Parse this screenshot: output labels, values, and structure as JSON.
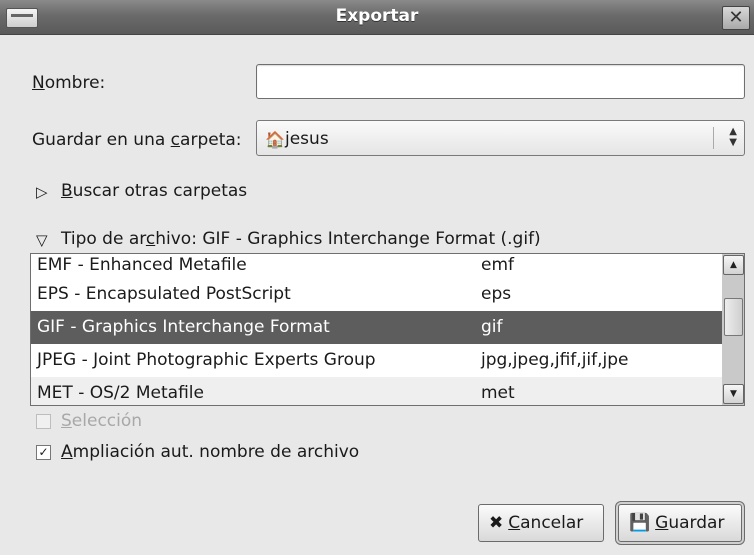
{
  "window": {
    "title": "Exportar",
    "close_glyph": "✕"
  },
  "name_field": {
    "label_prefix": "",
    "mnemonic": "N",
    "label_rest": "ombre:",
    "value": ""
  },
  "folder": {
    "label_prefix": "Guardar en una ",
    "mnemonic": "c",
    "label_rest": "arpeta:",
    "value": "jesus",
    "icon": "folder-home-icon"
  },
  "browse": {
    "expander": "▷",
    "mnemonic": "B",
    "label_rest": "uscar otras carpetas"
  },
  "filetype": {
    "expander": "▽",
    "label_prefix": "Tipo de ar",
    "mnemonic": "c",
    "label_rest": "hivo: GIF - Graphics Interchange Format (.gif)",
    "rows": [
      {
        "name": "EMF - Enhanced Metafile",
        "ext": "emf"
      },
      {
        "name": "EPS - Encapsulated PostScript",
        "ext": "eps"
      },
      {
        "name": "GIF - Graphics Interchange Format",
        "ext": "gif"
      },
      {
        "name": "JPEG - Joint Photographic Experts Group",
        "ext": "jpg,jpeg,jfif,jif,jpe"
      },
      {
        "name": "MET - OS/2 Metafile",
        "ext": "met"
      }
    ],
    "selected_index": 2
  },
  "options": {
    "selection": {
      "mnemonic": "S",
      "label_rest": "elección",
      "checked": false,
      "enabled": false
    },
    "auto_ext": {
      "mnemonic": "A",
      "label_rest": "mpliación aut. nombre de archivo",
      "checked": true,
      "check_glyph": "✓"
    }
  },
  "buttons": {
    "cancel": {
      "icon": "✖",
      "mnemonic": "C",
      "label_rest": "ancelar"
    },
    "save": {
      "icon": "💾",
      "mnemonic": "G",
      "label_rest": "uardar"
    }
  },
  "scrollbar": {
    "up": "▲",
    "down": "▼"
  },
  "combo_arrows": {
    "up": "▲",
    "down": "▼"
  }
}
